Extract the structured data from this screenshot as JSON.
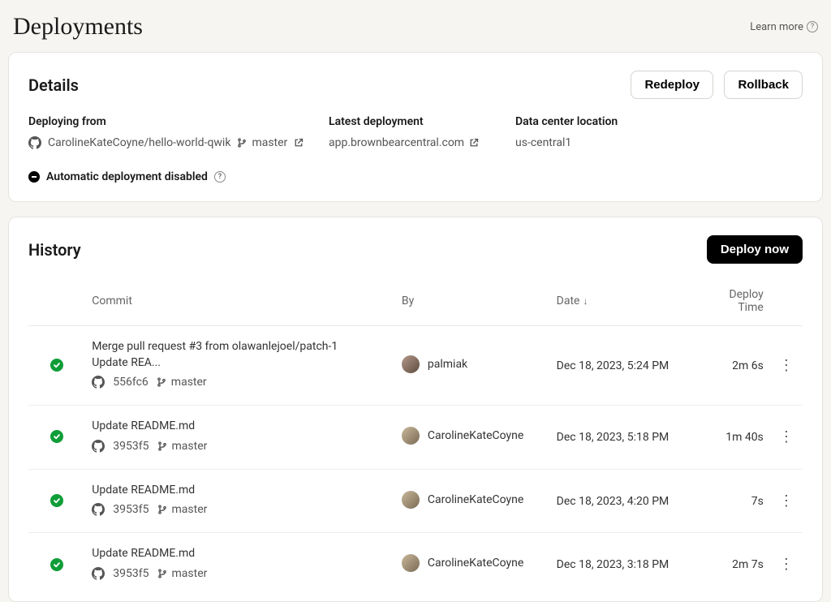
{
  "header": {
    "title": "Deployments",
    "learn_more": "Learn more"
  },
  "details": {
    "title": "Details",
    "redeploy_label": "Redeploy",
    "rollback_label": "Rollback",
    "deploying_from_label": "Deploying from",
    "latest_deployment_label": "Latest deployment",
    "data_center_label": "Data center location",
    "repo": "CarolineKateCoyne/hello-world-qwik",
    "branch": "master",
    "latest_deployment": "app.brownbearcentral.com",
    "data_center": "us-central1",
    "auto_deploy_status": "Automatic deployment disabled"
  },
  "history": {
    "title": "History",
    "deploy_now_label": "Deploy now",
    "columns": {
      "commit": "Commit",
      "by": "By",
      "date": "Date",
      "deploy_time": "Deploy Time"
    },
    "rows": [
      {
        "message": "Merge pull request #3 from olawanlejoel/patch-1 Update REA...",
        "sha": "556fc6",
        "branch": "master",
        "by": "palmiak",
        "date": "Dec 18, 2023, 5:24 PM",
        "deploy_time": "2m 6s",
        "avatar_variant": "alt"
      },
      {
        "message": "Update README.md",
        "sha": "3953f5",
        "branch": "master",
        "by": "CarolineKateCoyne",
        "date": "Dec 18, 2023, 5:18 PM",
        "deploy_time": "1m 40s",
        "avatar_variant": ""
      },
      {
        "message": "Update README.md",
        "sha": "3953f5",
        "branch": "master",
        "by": "CarolineKateCoyne",
        "date": "Dec 18, 2023, 4:20 PM",
        "deploy_time": "7s",
        "avatar_variant": ""
      },
      {
        "message": "Update README.md",
        "sha": "3953f5",
        "branch": "master",
        "by": "CarolineKateCoyne",
        "date": "Dec 18, 2023, 3:18 PM",
        "deploy_time": "2m 7s",
        "avatar_variant": ""
      }
    ]
  }
}
